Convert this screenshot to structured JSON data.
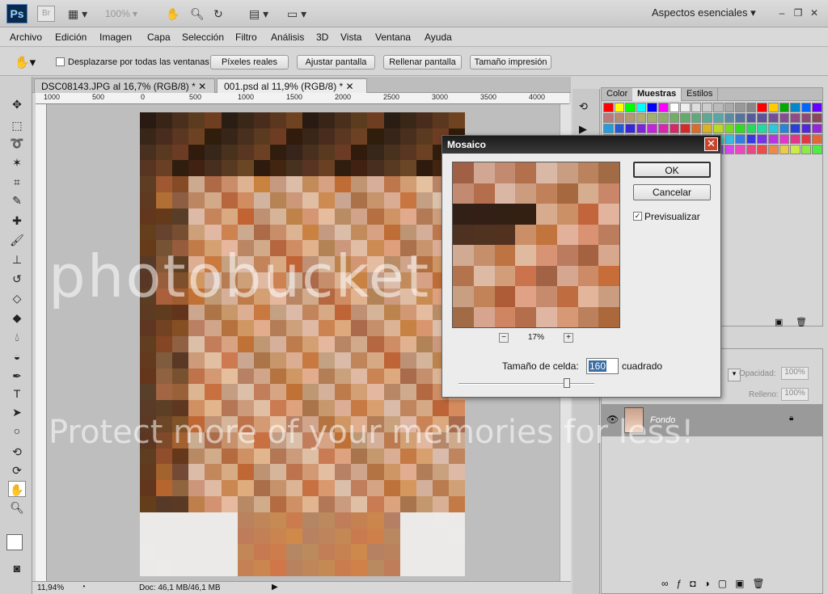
{
  "app": {
    "logo": "Ps",
    "bridge": "Br",
    "zoom": "100%",
    "workspace": "Aspectos esenciales"
  },
  "menu": [
    "Archivo",
    "Edición",
    "Imagen",
    "Capa",
    "Selección",
    "Filtro",
    "Análisis",
    "3D",
    "Vista",
    "Ventana",
    "Ayuda"
  ],
  "options": {
    "scroll_all_label": "Desplazarse por todas las ventanas",
    "btn_actual": "Píxeles reales",
    "btn_fit": "Ajustar pantalla",
    "btn_fill": "Rellenar pantalla",
    "btn_print": "Tamaño impresión"
  },
  "tabs": [
    {
      "label": "DSC08143.JPG al 16,7% (RGB/8) *"
    },
    {
      "label": "001.psd al 11,9% (RGB/8) *"
    }
  ],
  "ruler_labels": [
    "1000",
    "500",
    "0",
    "500",
    "1000",
    "1500",
    "2000",
    "2500",
    "3000",
    "3500",
    "4000"
  ],
  "status": {
    "zoom": "11,94%",
    "doc": "Doc: 46,1 MB/46,1 MB"
  },
  "panels": {
    "color_tab": "Color",
    "swatches_tab": "Muestras",
    "styles_tab": "Estilos",
    "opacity_label": "Opacidad:",
    "opacity_value": "100%",
    "fill_label": "Relleno:",
    "fill_value": "100%",
    "layer_name": "Fondo"
  },
  "dialog": {
    "title": "Mosaico",
    "ok": "OK",
    "cancel": "Cancelar",
    "preview_label": "Previsualizar",
    "zoom": "17%",
    "cell_label": "Tamaño de celda:",
    "cell_value": "160",
    "cell_unit": "cuadrado"
  },
  "watermark": {
    "main": "photobucket",
    "tagline": "Protect more of your memories for less!"
  }
}
